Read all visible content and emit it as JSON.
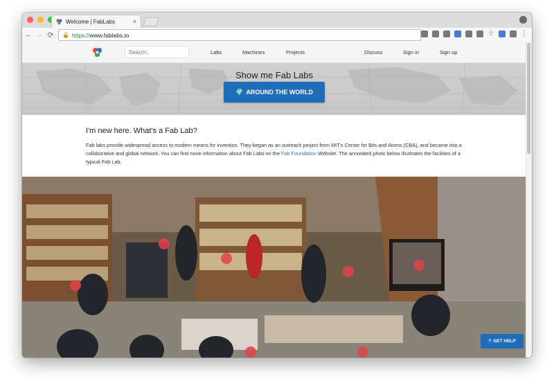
{
  "browser": {
    "tab_title": "Welcome | FabLabs",
    "tab_close": "×",
    "url_scheme": "https://",
    "url_host": "www.fablabs.io",
    "back_icon": "←",
    "forward_icon": "→",
    "reload_icon": "⟳",
    "lock_icon": "🔒",
    "star_icon": "☆",
    "menu_icon": "⋮"
  },
  "site": {
    "search_placeholder": "Search..",
    "nav_left": [
      "Labs",
      "Machines",
      "Projects"
    ],
    "nav_right": [
      "Discuss",
      "Sign in",
      "Sign up"
    ]
  },
  "hero": {
    "title": "Show me Fab Labs",
    "button_label": "AROUND THE WORLD",
    "button_icon": "🌍"
  },
  "intro": {
    "heading": "I'm new here. What's a Fab Lab?",
    "text_1": "Fab labs provide widespread access to modern means for invention. They began as an outreach project from MIT's Center for Bits and Atoms (CBA), and became into a collaborative and global network. You can find more information about Fab Labs on the ",
    "link": "Fab Foundation",
    "text_2": " Website. The annotated photo below illustrates the facilities of a typical Fab Lab."
  },
  "help": {
    "label": "GET HELP",
    "icon": "?"
  },
  "colors": {
    "accent": "#1f6db8",
    "link": "#2f74c0",
    "hotspot": "#e2424a"
  }
}
